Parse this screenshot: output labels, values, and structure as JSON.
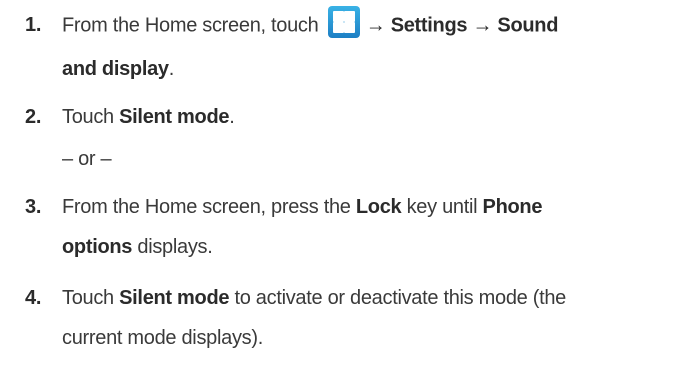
{
  "steps": [
    {
      "number": "1.",
      "lines": [
        {
          "t1": "From the Home screen, touch",
          "arrow1": "→",
          "settings": "Settings",
          "arrow2": "→",
          "sound": "Sound"
        },
        {
          "bold": "and display",
          "end": "."
        }
      ]
    },
    {
      "number": "2.",
      "lines": [
        {
          "t1": "Touch",
          "bold": "Silent mode",
          "end": "."
        }
      ]
    },
    {
      "separator": "– or –"
    },
    {
      "number": "3.",
      "lines": [
        {
          "t1": "From the Home screen, press the",
          "bold1": "Lock",
          "t2": "key until",
          "bold2": "Phone"
        },
        {
          "bold": "options",
          "t1": "displays."
        }
      ]
    },
    {
      "number": "4.",
      "lines": [
        {
          "t1": "Touch",
          "bold": "Silent mode",
          "t2": "to activate or deactivate this mode (the"
        },
        {
          "t1": "current mode displays)."
        }
      ]
    }
  ],
  "icons": {
    "apps": "apps-grid-icon"
  },
  "colors": {
    "text": "#3a3a3a",
    "bold_text": "#2b2b2b",
    "icon_top": "#39b2e6",
    "icon_bottom": "#1d7fc4"
  }
}
